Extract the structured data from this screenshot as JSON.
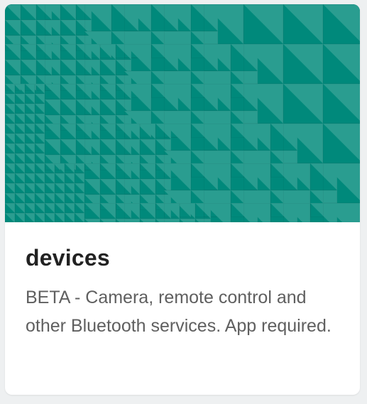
{
  "card": {
    "title": "devices",
    "description": "BETA - Camera, remote control and other Bluetooth services. App required.",
    "banner_color": "#00897b",
    "pattern_color": "#2a9d90"
  }
}
